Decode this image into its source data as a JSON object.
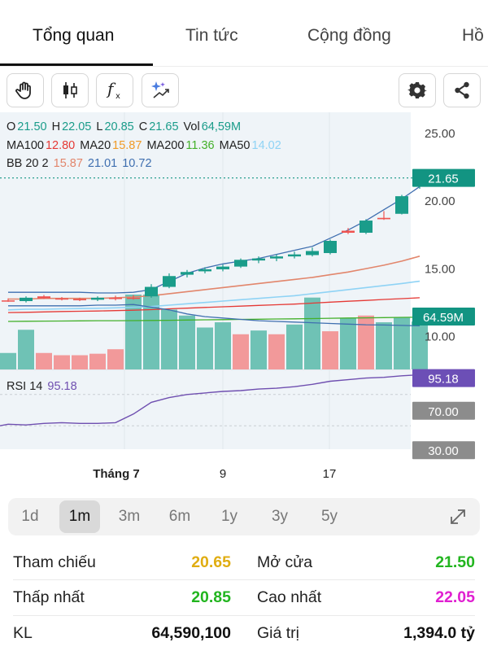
{
  "tabs": [
    {
      "label": "Tổng quan",
      "active": true
    },
    {
      "label": "Tin tức",
      "active": false
    },
    {
      "label": "Cộng đồng",
      "active": false
    },
    {
      "label": "Hồ",
      "active": false
    }
  ],
  "toolbar": {
    "left": [
      "hand-draw-icon",
      "candlestick-icon",
      "function-icon",
      "ai-sparkle-icon"
    ],
    "right": [
      "settings-gear-icon",
      "share-icon"
    ]
  },
  "ohlc": {
    "o_label": "O",
    "o": "21.50",
    "h_label": "H",
    "h": "22.05",
    "l_label": "L",
    "l": "20.85",
    "c_label": "C",
    "c": "21.65",
    "vol_label": "Vol",
    "vol": "64,59M"
  },
  "ma": {
    "ma100_label": "MA100",
    "ma100": "12.80",
    "ma20_label": "MA20",
    "ma20": "15.87",
    "ma200_label": "MA200",
    "ma200": "11.36",
    "ma50_label": "MA50",
    "ma50": "14.02"
  },
  "bb": {
    "label": "BB 20 2",
    "v1": "15.87",
    "v2": "21.01",
    "v3": "10.72"
  },
  "rsi": {
    "label": "RSI 14",
    "value": "95.18"
  },
  "price_badge": "21.65",
  "volume_badge": "64.59M",
  "rsi_badge": "95.18",
  "rsi_levels": [
    "70.00",
    "30.00"
  ],
  "colors": {
    "up": "#1a9c8a",
    "down": "#ef5350",
    "vol_up": "#6fc2b5",
    "vol_down": "#f2999a",
    "ma100": "#e53935",
    "ma20": "#f09b27",
    "ma200": "#43b02a",
    "ma50": "#8fd3f5",
    "bb_basis": "#e2866c",
    "bb_band": "#3f6fb0",
    "rsi": "#6f4fb0",
    "price_badge": "#129482",
    "rsi_badge": "#6c4fb6",
    "level_badge": "#8c8c8c",
    "ref": "#e0ad12",
    "green": "#22b51f",
    "magenta": "#e01fd1"
  },
  "chart_data": {
    "type": "candlestick",
    "ylim": [
      7.5,
      26.5
    ],
    "y_ticks": [
      "25.00",
      "20.00",
      "15.00",
      "10.00"
    ],
    "x_ticks": [
      {
        "label": "Tháng 7",
        "bold": true
      },
      {
        "label": "9",
        "bold": false
      },
      {
        "label": "17",
        "bold": false
      }
    ],
    "candles": [
      {
        "o": 12.6,
        "h": 12.75,
        "l": 12.5,
        "c": 12.55
      },
      {
        "o": 12.55,
        "h": 12.9,
        "l": 12.45,
        "c": 12.8
      },
      {
        "o": 12.9,
        "h": 13.0,
        "l": 12.7,
        "c": 12.75
      },
      {
        "o": 12.75,
        "h": 12.85,
        "l": 12.6,
        "c": 12.7
      },
      {
        "o": 12.7,
        "h": 12.8,
        "l": 12.55,
        "c": 12.65
      },
      {
        "o": 12.65,
        "h": 12.9,
        "l": 12.55,
        "c": 12.8
      },
      {
        "o": 12.8,
        "h": 12.95,
        "l": 12.6,
        "c": 12.7
      },
      {
        "o": 12.8,
        "h": 13.0,
        "l": 12.65,
        "c": 12.75
      },
      {
        "o": 12.9,
        "h": 13.8,
        "l": 12.8,
        "c": 13.6
      },
      {
        "o": 13.6,
        "h": 14.6,
        "l": 13.5,
        "c": 14.4
      },
      {
        "o": 14.5,
        "h": 14.85,
        "l": 14.3,
        "c": 14.7
      },
      {
        "o": 14.75,
        "h": 15.05,
        "l": 14.6,
        "c": 14.9
      },
      {
        "o": 14.9,
        "h": 15.25,
        "l": 14.75,
        "c": 15.1
      },
      {
        "o": 15.1,
        "h": 15.7,
        "l": 15.0,
        "c": 15.6
      },
      {
        "o": 15.55,
        "h": 15.85,
        "l": 15.35,
        "c": 15.7
      },
      {
        "o": 15.7,
        "h": 16.0,
        "l": 15.5,
        "c": 15.85
      },
      {
        "o": 15.85,
        "h": 16.2,
        "l": 15.7,
        "c": 16.0
      },
      {
        "o": 15.95,
        "h": 16.5,
        "l": 15.85,
        "c": 16.25
      },
      {
        "o": 16.1,
        "h": 17.1,
        "l": 16.0,
        "c": 17.0
      },
      {
        "o": 17.75,
        "h": 17.95,
        "l": 17.5,
        "c": 17.6
      },
      {
        "o": 17.6,
        "h": 18.6,
        "l": 17.5,
        "c": 18.5
      },
      {
        "o": 18.7,
        "h": 19.2,
        "l": 18.55,
        "c": 18.6
      },
      {
        "o": 19.0,
        "h": 20.4,
        "l": 18.95,
        "c": 20.3
      },
      {
        "o": 21.5,
        "h": 22.05,
        "l": 20.85,
        "c": 21.65
      }
    ],
    "volume_relative": [
      0.22,
      0.53,
      0.22,
      0.19,
      0.19,
      0.21,
      0.27,
      1.0,
      1.0,
      0.8,
      0.72,
      0.56,
      0.63,
      0.47,
      0.52,
      0.47,
      0.6,
      0.96,
      0.51,
      0.69,
      0.72,
      0.63,
      0.69,
      0.64
    ],
    "volume_up": [
      true,
      true,
      false,
      false,
      false,
      false,
      false,
      true,
      true,
      true,
      true,
      true,
      true,
      false,
      true,
      false,
      true,
      true,
      false,
      true,
      false,
      true,
      true,
      true
    ],
    "ma20": [
      12.7,
      12.7,
      12.75,
      12.75,
      12.75,
      12.75,
      12.8,
      12.85,
      12.95,
      13.1,
      13.25,
      13.4,
      13.55,
      13.7,
      13.85,
      14.0,
      14.15,
      14.3,
      14.5,
      14.7,
      14.95,
      15.2,
      15.5,
      15.87
    ],
    "ma50": [
      11.9,
      11.95,
      11.95,
      11.98,
      12.0,
      12.02,
      12.05,
      12.1,
      12.15,
      12.25,
      12.35,
      12.45,
      12.55,
      12.65,
      12.75,
      12.85,
      12.95,
      13.1,
      13.25,
      13.4,
      13.55,
      13.7,
      13.85,
      14.02
    ],
    "ma100": [
      11.7,
      11.72,
      11.75,
      11.78,
      11.8,
      11.82,
      11.85,
      11.88,
      11.92,
      11.98,
      12.03,
      12.08,
      12.13,
      12.18,
      12.23,
      12.28,
      12.33,
      12.4,
      12.47,
      12.54,
      12.6,
      12.67,
      12.73,
      12.8
    ],
    "ma200": [
      11.05,
      11.06,
      11.07,
      11.08,
      11.09,
      11.1,
      11.1,
      11.11,
      11.12,
      11.13,
      11.15,
      11.17,
      11.18,
      11.2,
      11.21,
      11.23,
      11.24,
      11.26,
      11.28,
      11.3,
      11.31,
      11.33,
      11.35,
      11.36
    ],
    "bb_upper": [
      13.2,
      13.2,
      13.2,
      13.2,
      13.2,
      13.15,
      13.15,
      13.2,
      13.4,
      14.0,
      14.6,
      15.0,
      15.3,
      15.5,
      15.7,
      16.0,
      16.3,
      16.6,
      17.2,
      17.8,
      18.5,
      19.3,
      20.1,
      21.01
    ],
    "bb_lower": [
      12.2,
      12.2,
      12.2,
      12.2,
      12.2,
      12.25,
      12.25,
      12.3,
      12.1,
      11.9,
      11.6,
      11.4,
      11.3,
      11.2,
      11.1,
      11.05,
      11.0,
      10.95,
      10.9,
      10.85,
      10.8,
      10.78,
      10.75,
      10.72
    ],
    "rsi": [
      32,
      31,
      33,
      34,
      33,
      33,
      34,
      45,
      60,
      66,
      70,
      72,
      74,
      75,
      77,
      78,
      80,
      83,
      87,
      89,
      91,
      92,
      94,
      95.18
    ],
    "last_price": 21.65
  },
  "time_ranges": [
    {
      "label": "1d",
      "active": false
    },
    {
      "label": "1m",
      "active": true
    },
    {
      "label": "3m",
      "active": false
    },
    {
      "label": "6m",
      "active": false
    },
    {
      "label": "1y",
      "active": false
    },
    {
      "label": "3y",
      "active": false
    },
    {
      "label": "5y",
      "active": false
    }
  ],
  "stats": {
    "ref_label": "Tham chiếu",
    "ref_value": "20.65",
    "open_label": "Mở cửa",
    "open_value": "21.50",
    "low_label": "Thấp nhất",
    "low_value": "20.85",
    "high_label": "Cao nhất",
    "high_value": "22.05",
    "vol_label": "KL",
    "vol_value": "64,590,100",
    "value_label": "Giá trị",
    "value_value": "1,394.0 tỷ"
  }
}
